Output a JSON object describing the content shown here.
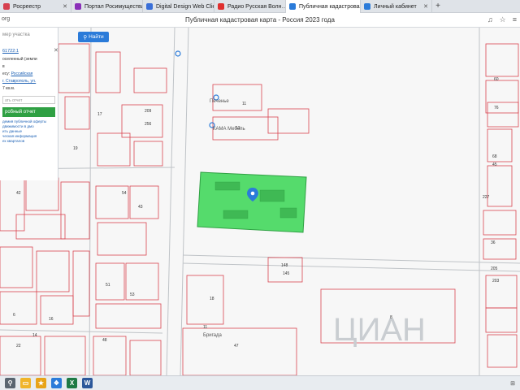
{
  "browser": {
    "tabs": [
      {
        "label": "Росреестр",
        "color": "#d6404e"
      },
      {
        "label": "Портал Росимущества",
        "color": "#8a2fb8"
      },
      {
        "label": "Digital Design Web Client",
        "color": "#3a6fd8"
      },
      {
        "label": "Радио Русская Волн…",
        "color": "#e0302f"
      },
      {
        "label": "Публичная кадастровая",
        "color": "#2b7bd9",
        "active": true
      },
      {
        "label": "Личный кабинет",
        "color": "#2b7bd9"
      }
    ],
    "url": "org",
    "page_title": "Публичная кадастровая карта - Россия 2023 года"
  },
  "search": {
    "placeholder": "мер участка",
    "find_label": "Найти"
  },
  "panel": {
    "cadastral_number": "61722:1",
    "line1": "оселенный (земли",
    "line2": "в",
    "address_label": "есу:",
    "address_link": "Российская",
    "address_link2": "г. Ставрополь, ул.",
    "area": "7 кв.м.",
    "input_placeholder": "ать отчет",
    "report_button": "робный отчет",
    "note1": "демия публичной оферты",
    "note2": "движимости в дмо",
    "note3": "ить данные",
    "note4": "ческая информация",
    "note5": "ех кварталов"
  },
  "map": {
    "selected_color": "#4cd964",
    "parcel_stroke": "#d9444f",
    "labels": {
      "p_11": "11",
      "p_13": "13",
      "p_209": "209",
      "p_256": "256",
      "p_17": "17",
      "p_19": "19",
      "p_42": "42",
      "p_54": "54",
      "p_43": "43",
      "p_51": "51",
      "p_53": "53",
      "p_18": "18",
      "p_8": "8",
      "p_60": "60",
      "p_76": "76",
      "p_68": "68",
      "p_45": "45",
      "p_227": "227",
      "p_36": "36",
      "p_205": "205",
      "p_203": "203",
      "p_47": "47",
      "p_11b": "11",
      "p_48": "48",
      "p_22": "22",
      "p_16": "16",
      "p_14": "14",
      "p_148": "148",
      "p_145": "145",
      "p_6": "6",
      "place1": "Печенье",
      "place2": "КАМА Мебель",
      "place3": "Бригада"
    }
  },
  "taskbar": {
    "icons": [
      {
        "name": "search",
        "color": "#5a6570",
        "glyph": "⚲"
      },
      {
        "name": "explorer",
        "color": "#f0b429",
        "glyph": "▭"
      },
      {
        "name": "favorites",
        "color": "#e8a317",
        "glyph": "★"
      },
      {
        "name": "gosuslugi",
        "color": "#2b7bd9",
        "glyph": "❖"
      },
      {
        "name": "excel",
        "color": "#1f7a45",
        "glyph": "X"
      },
      {
        "name": "word",
        "color": "#2b579a",
        "glyph": "W"
      }
    ]
  }
}
